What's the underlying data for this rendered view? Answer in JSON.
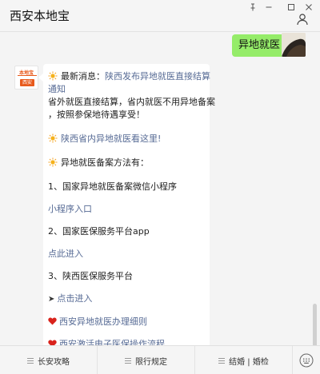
{
  "window": {
    "title": "西安本地宝",
    "pin_icon": "pin-icon",
    "min_icon": "minimize-icon",
    "max_icon": "maximize-icon",
    "close_icon": "close-icon"
  },
  "chat": {
    "user_message": "异地就医",
    "bot_avatar": {
      "brand": "本地宝",
      "tag": "西安"
    },
    "reply": {
      "news_prefix": "最新消息：",
      "news_link_line1": "陕西发布异地就医直接结算",
      "news_link_line2": "通知",
      "body_line1": "省外就医直接结算，省内就医不用异地备案",
      "body_line2": "，按照参保地待遇享受！",
      "link_inprov": "陕西省内异地就医看这里!",
      "methods_heading": "异地就医备案方法有：",
      "item1": "1、国家异地就医备案微信小程序",
      "item1_link": "小程序入口",
      "item2": "2、国家医保服务平台app",
      "item2_link": "点此进入",
      "item3": "3、陕西医保服务平台",
      "item3_link": "点击进入",
      "link_detail": "西安异地就医办理细则",
      "link_activate": "西安激活电子医保操作流程"
    }
  },
  "bottom_menu": {
    "items": [
      "长安攻略",
      "限行规定",
      "结婚 | 婚检"
    ],
    "keyboard_icon": "keyboard-icon"
  },
  "colors": {
    "link": "#576b95",
    "bubble_green": "#95ec69",
    "brand_orange": "#e85a1c"
  }
}
